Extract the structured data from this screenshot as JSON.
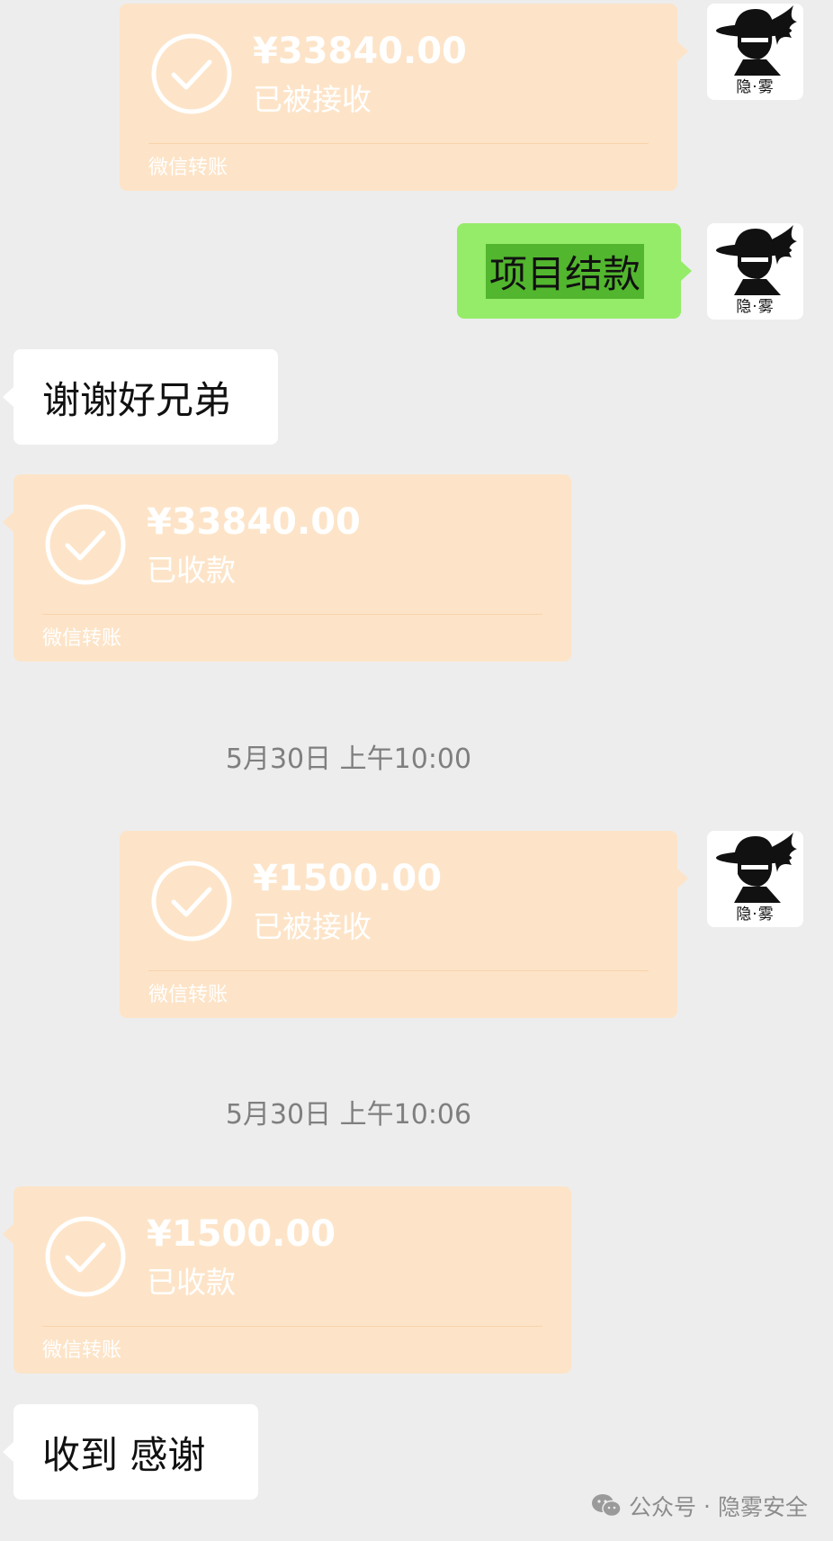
{
  "messages": [
    {
      "type": "transfer",
      "side": "right",
      "amount": "¥33840.00",
      "status": "已被接收",
      "source": "微信转账"
    },
    {
      "type": "text",
      "side": "right",
      "text": "项目结款"
    },
    {
      "type": "text",
      "side": "left",
      "text": "谢谢好兄弟"
    },
    {
      "type": "transfer",
      "side": "left",
      "amount": "¥33840.00",
      "status": "已收款",
      "source": "微信转账"
    },
    {
      "type": "time",
      "text": "5月30日 上午10:00"
    },
    {
      "type": "transfer",
      "side": "right",
      "amount": "¥1500.00",
      "status": "已被接收",
      "source": "微信转账"
    },
    {
      "type": "time",
      "text": "5月30日 上午10:06"
    },
    {
      "type": "transfer",
      "side": "left",
      "amount": "¥1500.00",
      "status": "已收款",
      "source": "微信转账"
    },
    {
      "type": "text",
      "side": "left",
      "text": "收到 感谢"
    }
  ],
  "avatar": {
    "label": "隐·雾",
    "icon": "hat-man-avatar-icon"
  },
  "watermark": {
    "prefix": "公众号",
    "separator": "·",
    "account": "隐雾安全",
    "icon": "wechat-icon"
  },
  "colors": {
    "background": "#ededed",
    "transfer_bubble": "#fde4c8",
    "sent_bubble": "#95ec69",
    "received_bubble": "#ffffff"
  }
}
